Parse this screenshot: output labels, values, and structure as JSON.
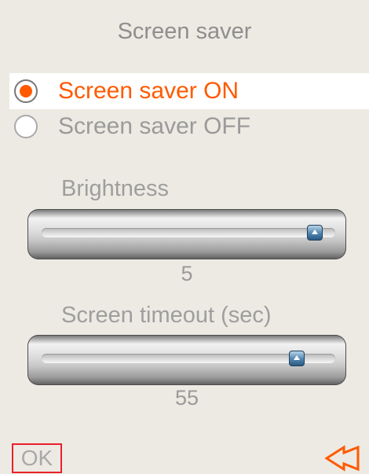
{
  "header": {
    "title": "Screen saver"
  },
  "options": [
    {
      "label": "Screen saver ON",
      "selected": true
    },
    {
      "label": "Screen saver OFF",
      "selected": false
    }
  ],
  "brightness": {
    "label": "Brightness",
    "value": "5",
    "level_fraction": 0.93
  },
  "timeout": {
    "label": "Screen timeout (sec)",
    "value": "55",
    "level_fraction": 0.87
  },
  "footer": {
    "ok_label": "OK",
    "back_icon": "back-arrow-icon"
  },
  "colors": {
    "accent": "#ff5a00",
    "background": "#edeae3",
    "focus_border": "#e8202a"
  }
}
